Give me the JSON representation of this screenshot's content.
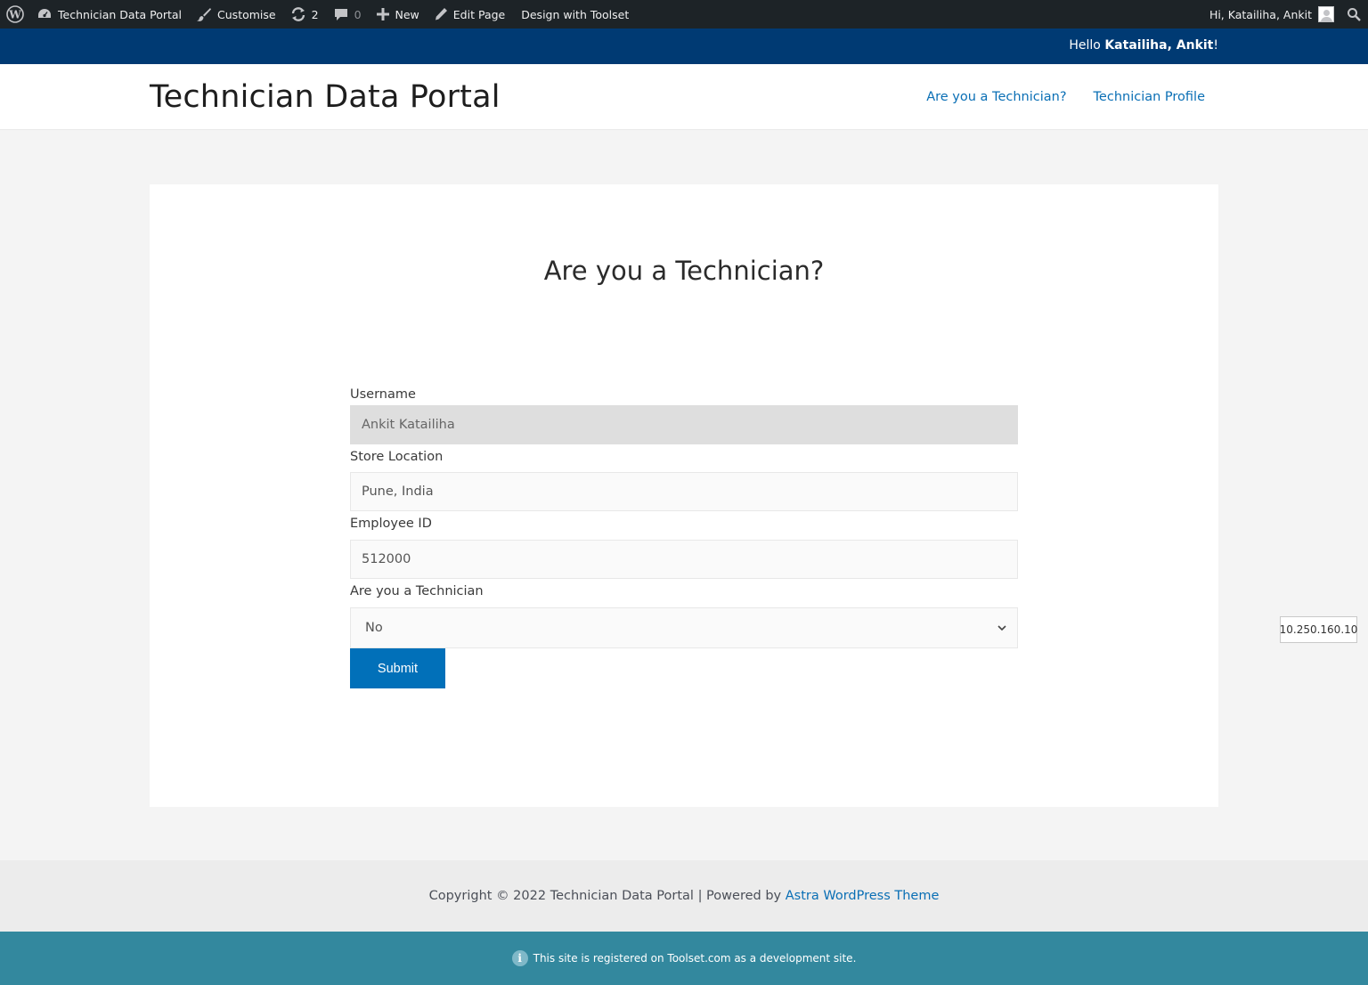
{
  "admin_bar": {
    "site_name": "Technician Data Portal",
    "customise": "Customise",
    "updates_count": "2",
    "comments_count": "0",
    "new": "New",
    "edit_page": "Edit Page",
    "design_with_toolset": "Design with Toolset",
    "howdy": "Hi, Katailiha, Ankit"
  },
  "greeting": {
    "prefix": "Hello ",
    "name": "Katailiha, Ankit",
    "suffix": "!"
  },
  "header": {
    "site_title": "Technician Data Portal",
    "nav": [
      "Are you a Technician?",
      "Technician Profile"
    ]
  },
  "main": {
    "heading": "Are you a Technician?",
    "form": {
      "username_label": "Username",
      "username_value": "Ankit Katailiha",
      "store_label": "Store Location",
      "store_value": "Pune, India",
      "employee_label": "Employee ID",
      "employee_value": "512000",
      "technician_label": "Are you a Technician",
      "technician_selected": "No",
      "submit_label": "Submit"
    }
  },
  "ip_tooltip": "10.250.160.10",
  "footer": {
    "copyright": "Copyright © 2022 Technician Data Portal | Powered by ",
    "theme_link": "Astra WordPress Theme",
    "dev_notice": "This site is registered on Toolset.com as a development site."
  },
  "colors": {
    "admin_bar_bg": "#1d2327",
    "greeting_bar_bg": "#003a73",
    "accent": "#0170b9",
    "dev_bar_bg": "#33889e"
  },
  "icons": [
    "wordpress-logo-icon",
    "dashboard-icon",
    "brush-icon",
    "updates-icon",
    "comment-icon",
    "plus-icon",
    "pencil-icon",
    "search-icon",
    "chevron-down-icon",
    "info-icon"
  ]
}
